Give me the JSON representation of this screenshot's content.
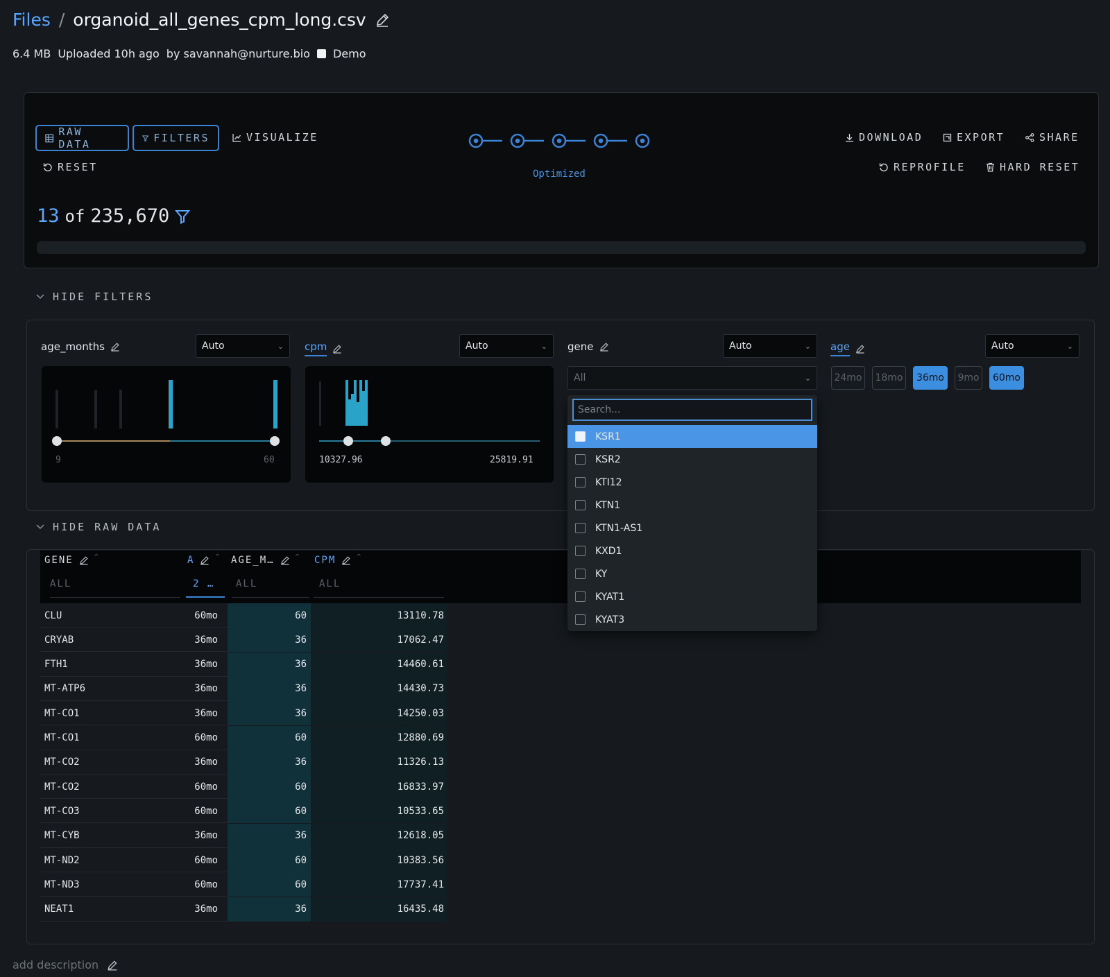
{
  "header": {
    "breadcrumb_root": "Files",
    "separator": "/",
    "file_name": "organoid_all_genes_cpm_long.csv",
    "size": "6.4 MB",
    "uploaded": "Uploaded 10h ago",
    "uploader": "by savannah@nurture.bio",
    "demo_label": "Demo"
  },
  "toolbar": {
    "raw_data": "RAW DATA",
    "filters": "FILTERS",
    "visualize": "VISUALIZE",
    "reset": "RESET",
    "download": "DOWNLOAD",
    "export": "EXPORT",
    "share": "SHARE",
    "reprofile": "REPROFILE",
    "hard_reset": "HARD RESET",
    "progress_label": "Optimized",
    "progress_steps": 5
  },
  "summary": {
    "shown": "13",
    "of_label": "of",
    "total": "235,670"
  },
  "filters_toggle": "HIDE FILTERS",
  "raw_toggle": "HIDE RAW DATA",
  "filters": {
    "age_months": {
      "label": "age_months",
      "mode": "Auto",
      "min": "9",
      "max": "60",
      "bars": [
        0.8,
        0.8,
        0.8,
        1.0,
        1.0
      ],
      "highlighted": [
        false,
        false,
        false,
        true,
        true
      ]
    },
    "cpm": {
      "label": "cpm",
      "mode": "Auto",
      "min": "10327.96",
      "max": "25819.91"
    },
    "gene": {
      "label": "gene",
      "mode": "Auto",
      "value": "All",
      "search_placeholder": "Search...",
      "options": [
        "KSR1",
        "KSR2",
        "KTI12",
        "KTN1",
        "KTN1-AS1",
        "KXD1",
        "KY",
        "KYAT1",
        "KYAT3"
      ],
      "highlighted_option": "KSR1"
    },
    "age": {
      "label": "age",
      "mode": "Auto",
      "chips": [
        {
          "label": "24mo",
          "on": false
        },
        {
          "label": "18mo",
          "on": false
        },
        {
          "label": "36mo",
          "on": true
        },
        {
          "label": "9mo",
          "on": false
        },
        {
          "label": "60mo",
          "on": true
        }
      ]
    }
  },
  "table": {
    "columns": [
      "GENE",
      "A",
      "AGE_M…",
      "CPM"
    ],
    "filters": [
      "ALL",
      "2 …",
      "ALL",
      "ALL"
    ],
    "rows": [
      [
        "CLU",
        "60mo",
        "60",
        "13110.78"
      ],
      [
        "CRYAB",
        "36mo",
        "36",
        "17062.47"
      ],
      [
        "FTH1",
        "36mo",
        "36",
        "14460.61"
      ],
      [
        "MT-ATP6",
        "36mo",
        "36",
        "14430.73"
      ],
      [
        "MT-CO1",
        "36mo",
        "36",
        "14250.03"
      ],
      [
        "MT-CO1",
        "60mo",
        "60",
        "12880.69"
      ],
      [
        "MT-CO2",
        "36mo",
        "36",
        "11326.13"
      ],
      [
        "MT-CO2",
        "60mo",
        "60",
        "16833.97"
      ],
      [
        "MT-CO3",
        "60mo",
        "60",
        "10533.65"
      ],
      [
        "MT-CYB",
        "36mo",
        "36",
        "12618.05"
      ],
      [
        "MT-ND2",
        "60mo",
        "60",
        "10383.56"
      ],
      [
        "MT-ND3",
        "60mo",
        "60",
        "17737.41"
      ],
      [
        "NEAT1",
        "36mo",
        "36",
        "16435.48"
      ]
    ]
  },
  "footer": {
    "description_placeholder": "add description"
  },
  "colors": {
    "accent": "#3b8ee0",
    "link": "#5aa7ff",
    "histogram": "#2aa3c9",
    "background": "#161a1e"
  }
}
